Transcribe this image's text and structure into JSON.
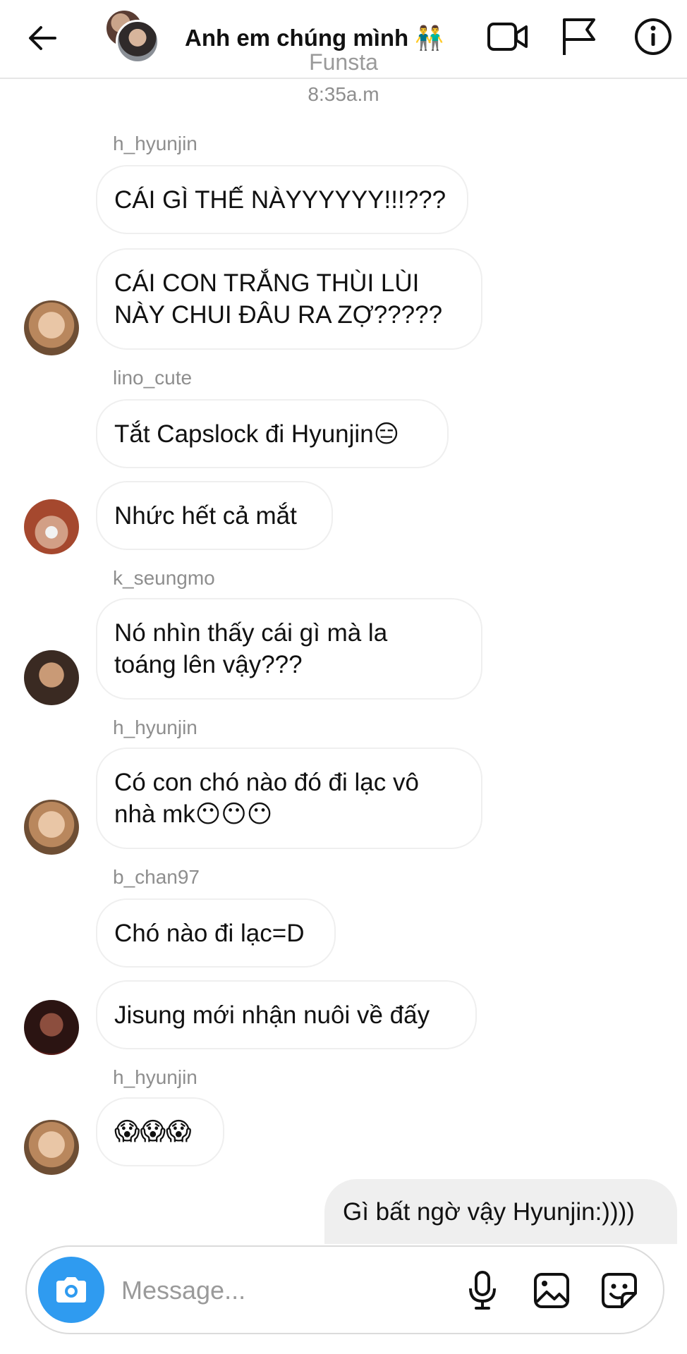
{
  "header": {
    "title": "Anh em chúng mình",
    "title_emoji": "👬",
    "icons": [
      "back-arrow-icon",
      "video-call-icon",
      "flag-icon",
      "info-icon"
    ]
  },
  "thread_meta": {
    "name": "Funsta",
    "time": "8:35a.m"
  },
  "messages": [
    {
      "sender": "h_hyunjin",
      "text": "CÁI GÌ THẾ NÀYYYYYY!!!???"
    },
    {
      "text": "CÁI CON TRẮNG THÙI LÙI\nNÀY CHUI ĐÂU RA ZỢ?????"
    },
    {
      "sender": "lino_cute",
      "text": "Tắt Capslock đi Hyunjin😑"
    },
    {
      "text": "Nhức hết cả mắt"
    },
    {
      "sender": "k_seungmo",
      "text": "Nó nhìn thấy cái gì mà la\ntoáng lên vậy???"
    },
    {
      "sender": "h_hyunjin",
      "text": "Có con chó nào đó đi lạc vô\nnhà mk😶😶😶"
    },
    {
      "sender": "b_chan97",
      "text": "Chó nào đi lạc=D"
    },
    {
      "text": "Jisung mới nhận nuôi về đấy"
    },
    {
      "sender": "h_hyunjin",
      "text": "😱😱😱"
    },
    {
      "text": "Gì bất ngờ vậy Hyunjin:))))"
    }
  ],
  "composer": {
    "placeholder": "Message..."
  },
  "colors": {
    "camera_button": "#2f9bf0",
    "own_bubble": "#efefef",
    "meta_text": "#8e8e8e"
  }
}
